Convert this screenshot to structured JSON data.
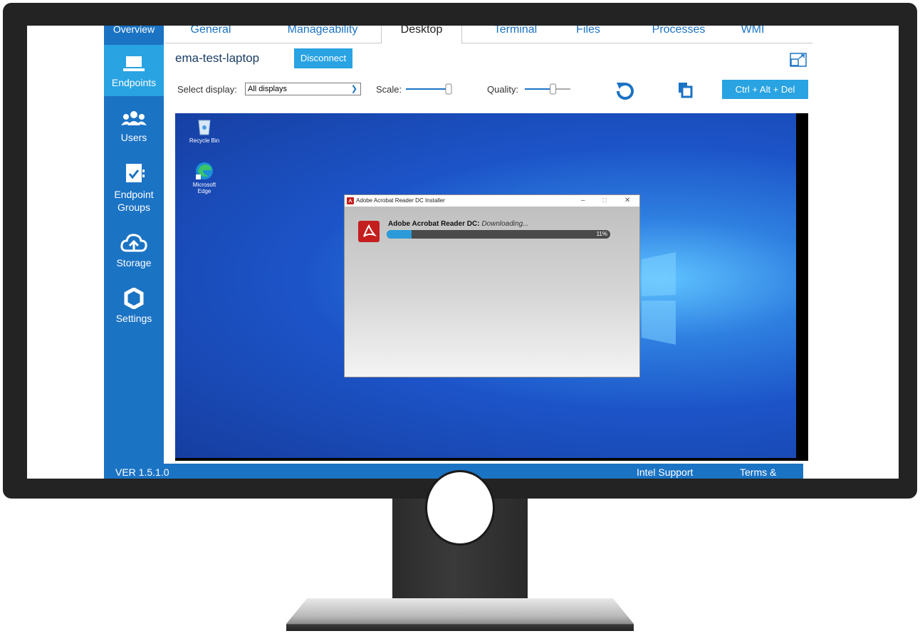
{
  "sidebar": {
    "overview_label": "Overview",
    "items": [
      {
        "label": "Endpoints",
        "icon": "laptop-icon",
        "active": true
      },
      {
        "label": "Users",
        "icon": "users-icon"
      },
      {
        "label": "Endpoint Groups",
        "icon": "endpoint-groups-icon"
      },
      {
        "label": "Storage",
        "icon": "cloud-upload-icon"
      },
      {
        "label": "Settings",
        "icon": "gear-icon"
      }
    ]
  },
  "tabs": [
    "General",
    "Manageability",
    "Desktop",
    "Terminal",
    "Files",
    "Processes",
    "WMI"
  ],
  "active_tab": "Desktop",
  "device": {
    "name": "ema-test-laptop",
    "disconnect_label": "Disconnect"
  },
  "toolbar": {
    "select_display_label": "Select display:",
    "select_display_value": "All displays",
    "scale_label": "Scale:",
    "scale_level": 1.0,
    "quality_label": "Quality:",
    "quality_level": 0.6,
    "cad_label": "Ctrl + Alt + Del",
    "refresh_icon": "refresh-icon",
    "clipboard_icon": "clipboard-icon",
    "fullscreen_icon": "fullscreen-icon"
  },
  "remote_desktop": {
    "icons": [
      {
        "label": "Recycle Bin",
        "icon": "recycle-bin-icon"
      },
      {
        "label": "Microsoft Edge",
        "icon": "edge-icon"
      }
    ],
    "dialog": {
      "title": "Adobe Acrobat Reader DC Installer",
      "product": "Adobe Acrobat Reader DC:",
      "status": "Downloading...",
      "progress_percent": 11,
      "progress_text": "11%",
      "minimize": "–",
      "maximize": "□",
      "close": "✕"
    }
  },
  "footer": {
    "version": "VER 1.5.1.0",
    "support": "Intel Support",
    "terms": "Terms & privacy"
  },
  "colors": {
    "sidebar": "#1b73c4",
    "accent": "#29a3e2",
    "bezel": "#232323"
  }
}
